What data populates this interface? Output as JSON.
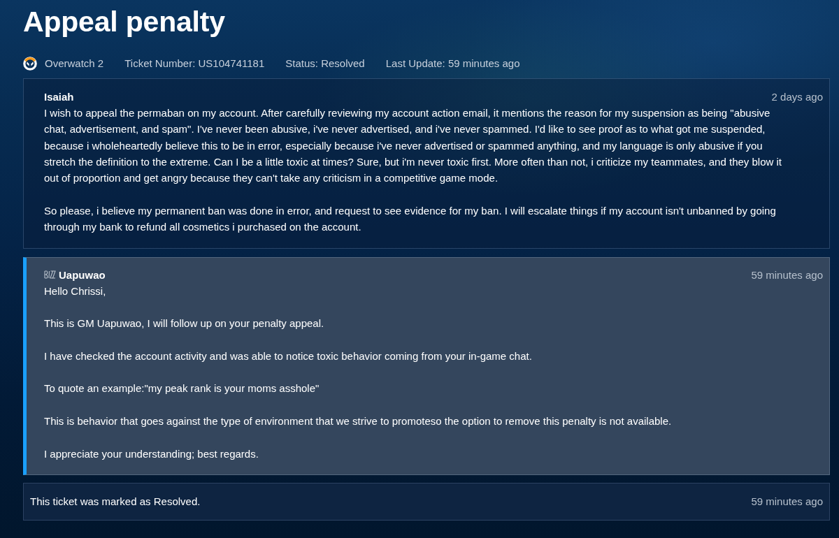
{
  "page": {
    "title": "Appeal penalty"
  },
  "ticket_info": [
    {
      "kind": "game",
      "text": "Overwatch 2"
    },
    {
      "kind": "field",
      "text": "Ticket Number: US104741181"
    },
    {
      "kind": "field",
      "text": "Status: Resolved"
    },
    {
      "kind": "field",
      "text": "Last Update: 59 minutes ago"
    }
  ],
  "messages": [
    {
      "kind": "customer",
      "author": "Isaiah",
      "time": "2 days ago",
      "paragraphs": [
        "I wish to appeal the permaban on my account. After carefully reviewing my account action email, it mentions the reason for my suspension as being \"abusive chat, advertisement, and spam\". I've never been abusive, i've never advertised, and i've never spammed. I'd like to see proof as to what got me suspended, because i wholeheartedly believe this to be in error, especially because i've never advertised or spammed anything, and my language is only abusive if you stretch the definition to the extreme. Can I be a little toxic at times? Sure, but i'm never toxic first. More often than not, i criticize my teammates, and they blow it out of proportion and get angry because they can't take any criticism in a competitive game mode.",
        "So please, i believe my permanent ban was done in error, and request to see evidence for my ban. I will escalate things if my account isn't unbanned by going through my bank to refund all cosmetics i purchased on the account."
      ]
    },
    {
      "kind": "agent",
      "author": "Uapuwao",
      "time": "59 minutes ago",
      "paragraphs": [
        "Hello Chrissi,",
        "This is GM Uapuwao, I will follow up on your penalty appeal.",
        "I have checked the account activity and was able to notice toxic behavior coming from your in-game chat.",
        "To quote an example:\"my peak rank is your moms asshole\"",
        "This is behavior that goes against the type of environment that we strive to promoteso the option to remove this penalty is not available.",
        "I appreciate your understanding; best regards."
      ]
    },
    {
      "kind": "system",
      "text": "This ticket was marked as Resolved.",
      "time": "59 minutes ago"
    }
  ]
}
